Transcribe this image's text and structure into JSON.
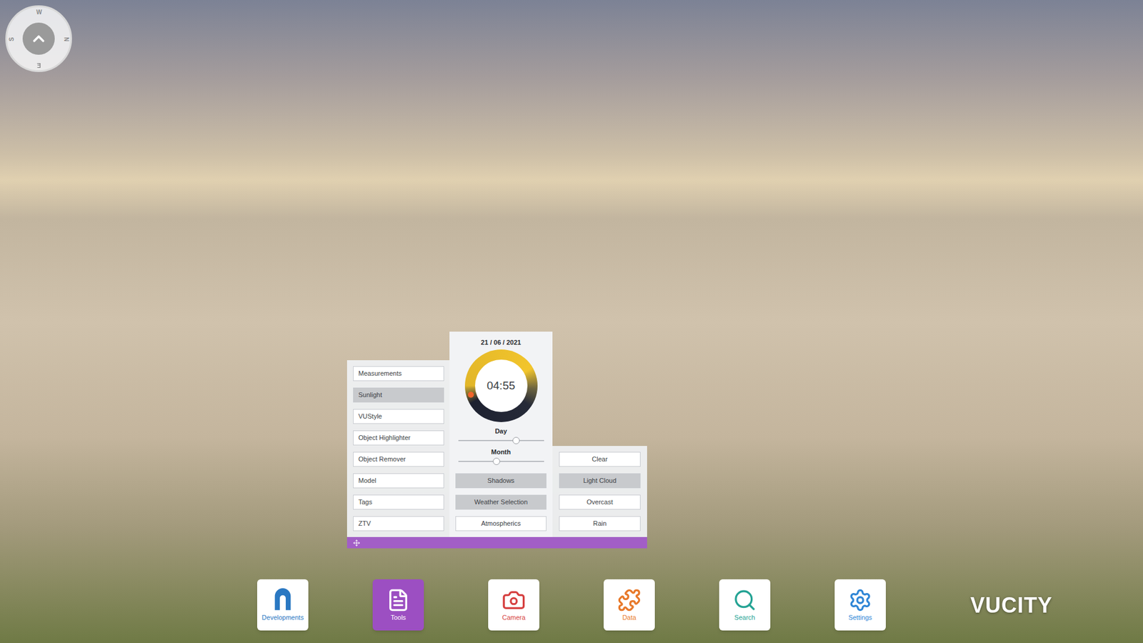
{
  "compass": {
    "labels": [
      "W",
      "N",
      "E",
      "S"
    ]
  },
  "tools_menu": [
    {
      "label": "Measurements",
      "selected": false
    },
    {
      "label": "Sunlight",
      "selected": true
    },
    {
      "label": "VUStyle",
      "selected": false
    },
    {
      "label": "Object Highlighter",
      "selected": false
    },
    {
      "label": "Object Remover",
      "selected": false
    },
    {
      "label": "Model",
      "selected": false
    },
    {
      "label": "Tags",
      "selected": false
    },
    {
      "label": "ZTV",
      "selected": false
    }
  ],
  "sunlight": {
    "date": "21 / 06 / 2021",
    "time": "04:55",
    "dial_level": 0.205,
    "sliders": [
      {
        "label": "Day",
        "level": 0.68
      },
      {
        "label": "Month",
        "level": 0.45
      }
    ],
    "options": [
      {
        "label": "Shadows",
        "selected": true
      },
      {
        "label": "Weather Selection",
        "selected": true
      },
      {
        "label": "Atmospherics",
        "selected": false
      }
    ]
  },
  "weather": [
    {
      "label": "Clear",
      "selected": false
    },
    {
      "label": "Light Cloud",
      "selected": true
    },
    {
      "label": "Overcast",
      "selected": false
    },
    {
      "label": "Rain",
      "selected": false
    }
  ],
  "toolbar": [
    {
      "label": "Developments",
      "selected": false,
      "color": "#2a78c2"
    },
    {
      "label": "Tools",
      "selected": true,
      "color": "#9c4fc2"
    },
    {
      "label": "Camera",
      "selected": false,
      "color": "#d64040"
    },
    {
      "label": "Data",
      "selected": false,
      "color": "#e8792a"
    },
    {
      "label": "Search",
      "selected": false,
      "color": "#24a394"
    },
    {
      "label": "Settings",
      "selected": false,
      "color": "#2f86d6"
    }
  ],
  "logo": "VUCITY"
}
